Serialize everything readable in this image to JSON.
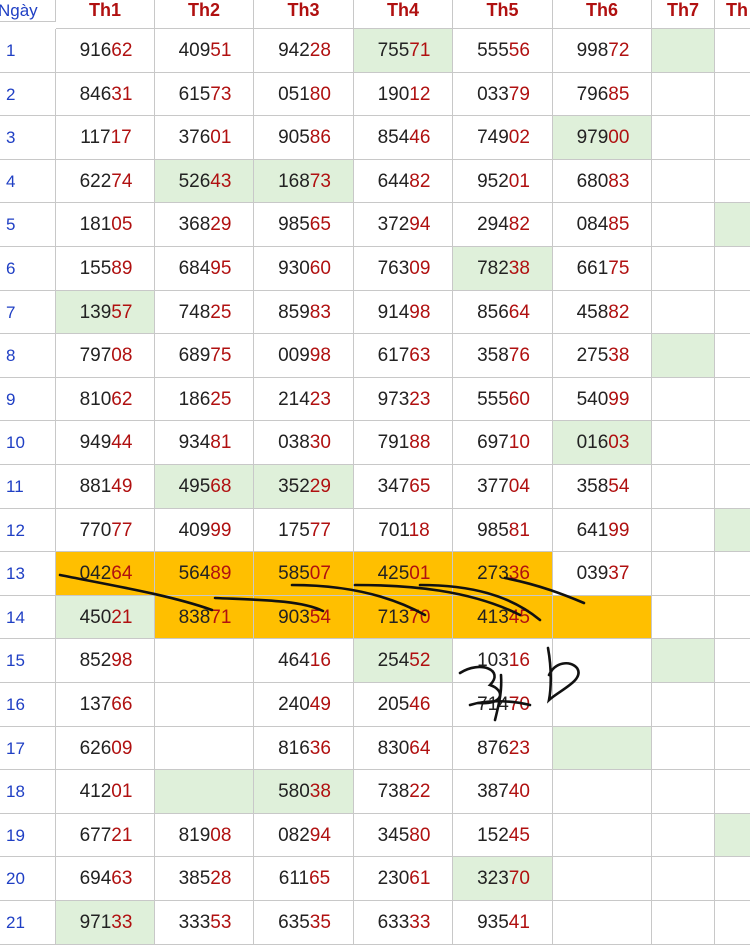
{
  "header": {
    "day_label": "Ngày",
    "columns": [
      "Th1",
      "Th2",
      "Th3",
      "Th4",
      "Th5",
      "Th6",
      "Th7",
      "Th"
    ]
  },
  "colors": {
    "accent_red": "#b01010",
    "day_blue": "#1f3fc4",
    "highlight_green": "#dff0da",
    "highlight_orange": "#ffbf00"
  },
  "rows": [
    {
      "day": "1",
      "values": [
        "91662",
        "40951",
        "94228",
        "75571",
        "55556",
        "99872",
        "",
        ""
      ]
    },
    {
      "day": "2",
      "values": [
        "84631",
        "61573",
        "05180",
        "19012",
        "03379",
        "79685",
        "",
        ""
      ]
    },
    {
      "day": "3",
      "values": [
        "11717",
        "37601",
        "90586",
        "85446",
        "74902",
        "97900",
        "",
        ""
      ]
    },
    {
      "day": "4",
      "values": [
        "62274",
        "52643",
        "16873",
        "64482",
        "95201",
        "68083",
        "",
        ""
      ]
    },
    {
      "day": "5",
      "values": [
        "18105",
        "36829",
        "98565",
        "37294",
        "29482",
        "08485",
        "",
        ""
      ]
    },
    {
      "day": "6",
      "values": [
        "15589",
        "68495",
        "93060",
        "76309",
        "78238",
        "66175",
        "",
        ""
      ]
    },
    {
      "day": "7",
      "values": [
        "13957",
        "74825",
        "85983",
        "91498",
        "85664",
        "45882",
        "",
        ""
      ]
    },
    {
      "day": "8",
      "values": [
        "79708",
        "68975",
        "00998",
        "61763",
        "35876",
        "27538",
        "",
        ""
      ]
    },
    {
      "day": "9",
      "values": [
        "81062",
        "18625",
        "21423",
        "97323",
        "55560",
        "54099",
        "",
        ""
      ]
    },
    {
      "day": "10",
      "values": [
        "94944",
        "93481",
        "03830",
        "79188",
        "69710",
        "01603",
        "",
        ""
      ]
    },
    {
      "day": "11",
      "values": [
        "88149",
        "49568",
        "35229",
        "34765",
        "37704",
        "35854",
        "",
        ""
      ]
    },
    {
      "day": "12",
      "values": [
        "77077",
        "40999",
        "17577",
        "70118",
        "98581",
        "64199",
        "",
        ""
      ]
    },
    {
      "day": "13",
      "values": [
        "04264",
        "56489",
        "58507",
        "42501",
        "27336",
        "03937",
        "",
        ""
      ]
    },
    {
      "day": "14",
      "values": [
        "45021",
        "83871",
        "90354",
        "71370",
        "41345",
        "",
        "",
        ""
      ]
    },
    {
      "day": "15",
      "values": [
        "85298",
        "",
        "46416",
        "25452",
        "10316",
        "",
        "",
        ""
      ]
    },
    {
      "day": "16",
      "values": [
        "13766",
        "",
        "24049",
        "20546",
        "71470",
        "",
        "",
        ""
      ]
    },
    {
      "day": "17",
      "values": [
        "62609",
        "",
        "81636",
        "83064",
        "87623",
        "",
        "",
        ""
      ]
    },
    {
      "day": "18",
      "values": [
        "41201",
        "",
        "58038",
        "73822",
        "38740",
        "",
        "",
        ""
      ]
    },
    {
      "day": "19",
      "values": [
        "67721",
        "81908",
        "08294",
        "34580",
        "15245",
        "",
        "",
        ""
      ]
    },
    {
      "day": "20",
      "values": [
        "69463",
        "38528",
        "61165",
        "23061",
        "32370",
        "",
        "",
        ""
      ]
    },
    {
      "day": "21",
      "values": [
        "97133",
        "33353",
        "63535",
        "63333",
        "93541",
        "",
        "",
        ""
      ]
    }
  ],
  "handwriting": {
    "text": "3, 6"
  }
}
